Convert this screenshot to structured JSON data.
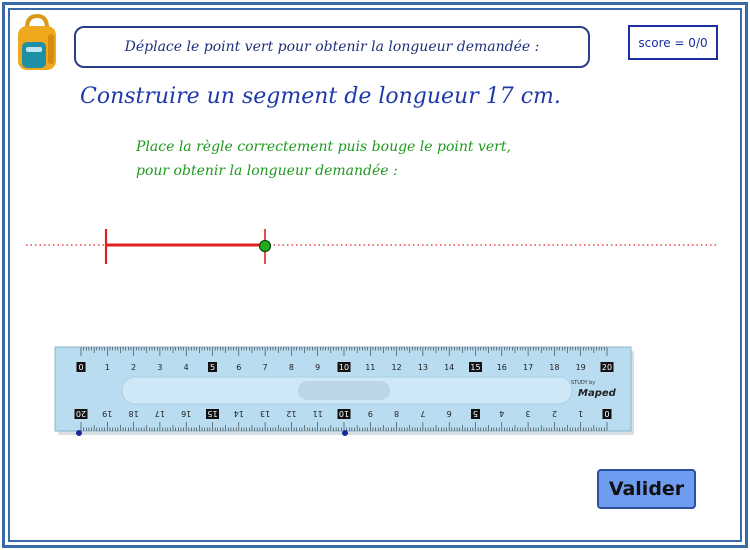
{
  "instruction": "Déplace le point vert pour obtenir la longueur demandée :",
  "score": "score = 0/0",
  "title": "Construire un segment de longueur 17 cm.",
  "hint_lines": [
    "Place la règle correctement puis bouge le point vert,",
    "pour obtenir la longueur demandée :"
  ],
  "ruler": {
    "top_numbers": [
      "0",
      "1",
      "2",
      "3",
      "4",
      "5",
      "6",
      "7",
      "8",
      "9",
      "10",
      "11",
      "12",
      "13",
      "14",
      "15",
      "16",
      "17",
      "18",
      "19",
      "20"
    ],
    "bottom_numbers": [
      "20",
      "19",
      "18",
      "17",
      "16",
      "15",
      "14",
      "13",
      "12",
      "11",
      "10",
      "9",
      "8",
      "7",
      "6",
      "5",
      "4",
      "3",
      "2",
      "1",
      "0"
    ],
    "brand_small": "STUDY by",
    "brand": "Maped"
  },
  "buttons": {
    "valider": "Valider"
  },
  "colors": {
    "frame": "#3b6aa8",
    "segment": "#e02020",
    "point_green": "#1faa1f",
    "point_blue": "#1a2a9a",
    "ruler": "#b9dcf0",
    "button": "#6d9cf0"
  }
}
